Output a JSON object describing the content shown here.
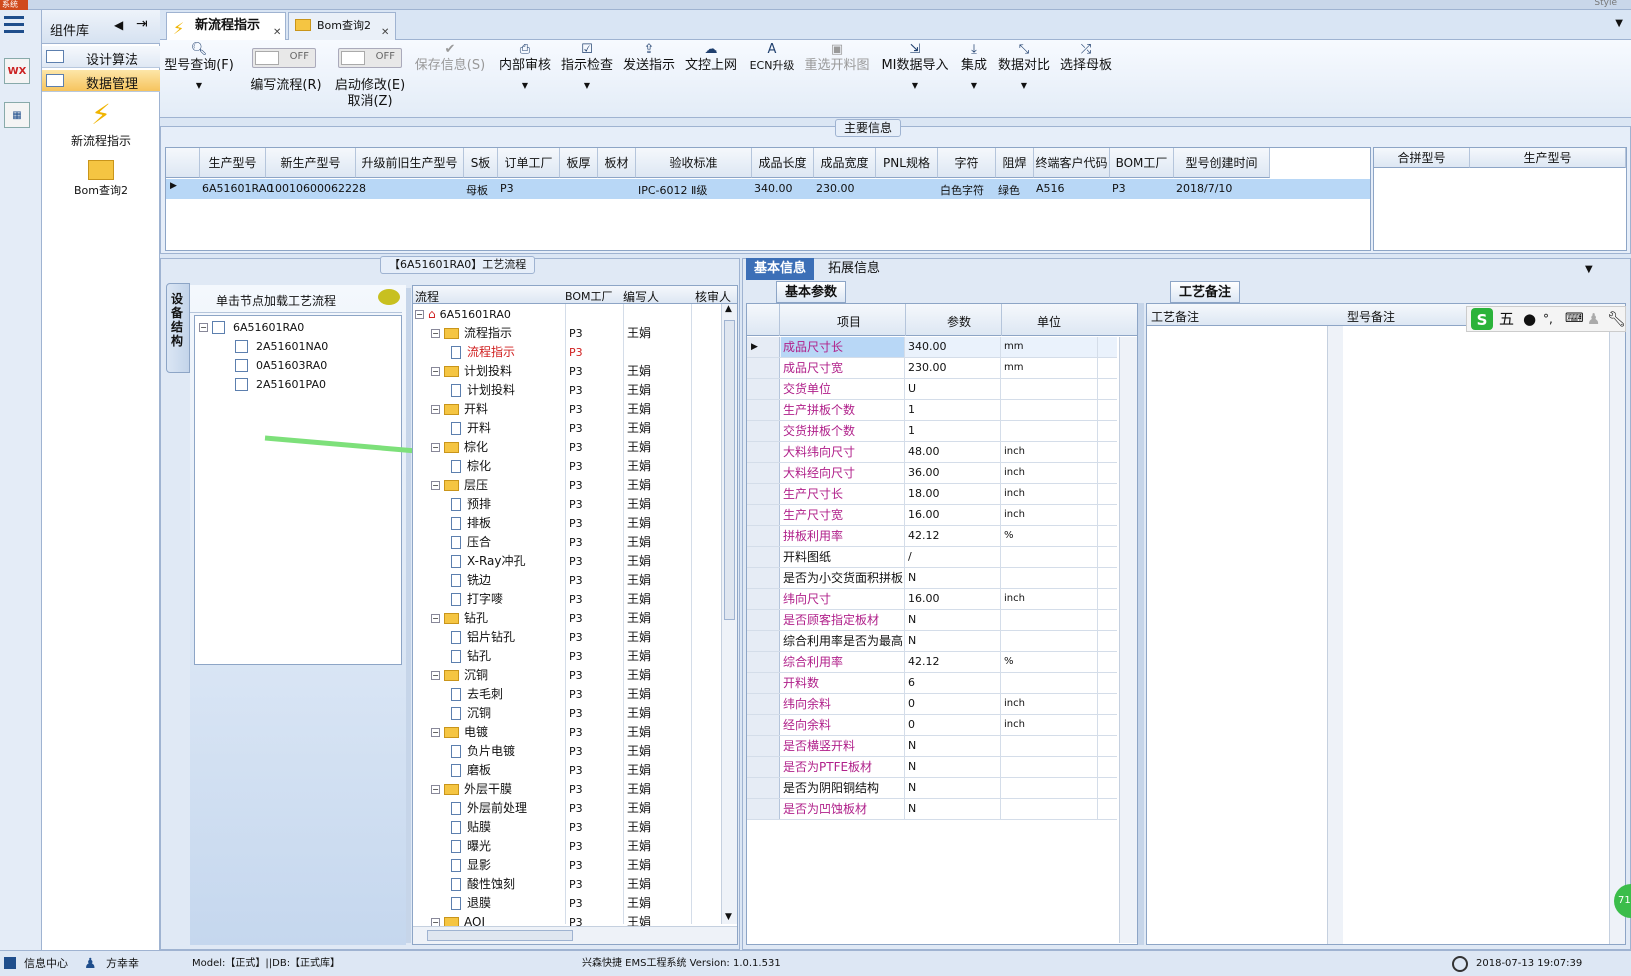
{
  "window": {
    "title_fragment": "系统",
    "style_label": "Style"
  },
  "component_panel": {
    "title": "组件库",
    "groups": [
      {
        "label": "设计算法"
      },
      {
        "label": "数据管理"
      }
    ],
    "items": [
      {
        "label": "新流程指示"
      },
      {
        "label": "Bom查询2"
      }
    ]
  },
  "tabs": [
    {
      "label": "新流程指示"
    },
    {
      "label": "Bom查询2"
    }
  ],
  "toolbar": {
    "model_query": "型号查询(F)",
    "write_flow": "编写流程(R)",
    "start_modify": "启动修改(E)",
    "cancel": "取消(Z)",
    "toggle_off": "OFF",
    "save": "保存信息(S)",
    "internal_review": "内部审核",
    "instruct_check": "指示检查",
    "send_instruct": "发送指示",
    "doc_upload": "文控上网",
    "ecn_upgrade": "ECN升级",
    "reselect_cut": "重选开料图",
    "mi_import": "MI数据导入",
    "integrate": "集成",
    "data_compare": "数据对比",
    "select_mother": "选择母板"
  },
  "main_info": {
    "title": "主要信息",
    "columns": [
      "生产型号",
      "新生产型号",
      "升级前旧生产型号",
      "S板",
      "订单工厂",
      "板厚",
      "板材",
      "验收标准",
      "成品长度",
      "成品宽度",
      "PNL规格",
      "字符",
      "阻焊",
      "终端客户代码",
      "BOM工厂",
      "型号创建时间"
    ],
    "row": [
      "6A51601RA0",
      "10010600062228",
      "",
      "母板",
      "P3",
      "",
      "",
      "IPC-6012 Ⅱ级",
      "340.00",
      "230.00",
      "",
      "白色字符",
      "绿色",
      "A516",
      "P3",
      "2018/7/10"
    ],
    "side_columns": [
      "合拼型号",
      "生产型号"
    ]
  },
  "flow_section": {
    "title": "【6A51601RA0】工艺流程"
  },
  "device_tree": {
    "vtab": "设备结构",
    "header": "单击节点加载工艺流程",
    "root": "6A51601RA0",
    "children": [
      "2A51601NA0",
      "0A51603RA0",
      "2A51601PA0"
    ]
  },
  "process_tree": {
    "columns": [
      "流程",
      "BOM工厂",
      "编写人",
      "核审人"
    ],
    "root": "6A51601RA0",
    "nodes": [
      {
        "t": "流程指示",
        "lvl": 1,
        "folder": true,
        "f": "P3",
        "w": "王娟"
      },
      {
        "t": "流程指示",
        "lvl": 2,
        "f": "P3",
        "w": "",
        "red": true
      },
      {
        "t": "计划投料",
        "lvl": 1,
        "folder": true,
        "f": "P3",
        "w": "王娟"
      },
      {
        "t": "计划投料",
        "lvl": 2,
        "f": "P3",
        "w": "王娟"
      },
      {
        "t": "开料",
        "lvl": 1,
        "folder": true,
        "f": "P3",
        "w": "王娟"
      },
      {
        "t": "开料",
        "lvl": 2,
        "f": "P3",
        "w": "王娟"
      },
      {
        "t": "棕化",
        "lvl": 1,
        "folder": true,
        "f": "P3",
        "w": "王娟"
      },
      {
        "t": "棕化",
        "lvl": 2,
        "f": "P3",
        "w": "王娟"
      },
      {
        "t": "层压",
        "lvl": 1,
        "folder": true,
        "f": "P3",
        "w": "王娟"
      },
      {
        "t": "预排",
        "lvl": 2,
        "f": "P3",
        "w": "王娟"
      },
      {
        "t": "排板",
        "lvl": 2,
        "f": "P3",
        "w": "王娟"
      },
      {
        "t": "压合",
        "lvl": 2,
        "f": "P3",
        "w": "王娟"
      },
      {
        "t": "X-Ray冲孔",
        "lvl": 2,
        "f": "P3",
        "w": "王娟"
      },
      {
        "t": "铣边",
        "lvl": 2,
        "f": "P3",
        "w": "王娟"
      },
      {
        "t": "打字嘜",
        "lvl": 2,
        "f": "P3",
        "w": "王娟"
      },
      {
        "t": "钻孔",
        "lvl": 1,
        "folder": true,
        "f": "P3",
        "w": "王娟"
      },
      {
        "t": "铝片钻孔",
        "lvl": 2,
        "f": "P3",
        "w": "王娟"
      },
      {
        "t": "钻孔",
        "lvl": 2,
        "f": "P3",
        "w": "王娟"
      },
      {
        "t": "沉铜",
        "lvl": 1,
        "folder": true,
        "f": "P3",
        "w": "王娟"
      },
      {
        "t": "去毛刺",
        "lvl": 2,
        "f": "P3",
        "w": "王娟"
      },
      {
        "t": "沉铜",
        "lvl": 2,
        "f": "P3",
        "w": "王娟"
      },
      {
        "t": "电镀",
        "lvl": 1,
        "folder": true,
        "f": "P3",
        "w": "王娟"
      },
      {
        "t": "负片电镀",
        "lvl": 2,
        "f": "P3",
        "w": "王娟"
      },
      {
        "t": "磨板",
        "lvl": 2,
        "f": "P3",
        "w": "王娟"
      },
      {
        "t": "外层干膜",
        "lvl": 1,
        "folder": true,
        "f": "P3",
        "w": "王娟"
      },
      {
        "t": "外层前处理",
        "lvl": 2,
        "f": "P3",
        "w": "王娟"
      },
      {
        "t": "贴膜",
        "lvl": 2,
        "f": "P3",
        "w": "王娟"
      },
      {
        "t": "曝光",
        "lvl": 2,
        "f": "P3",
        "w": "王娟"
      },
      {
        "t": "显影",
        "lvl": 2,
        "f": "P3",
        "w": "王娟"
      },
      {
        "t": "酸性蚀刻",
        "lvl": 2,
        "f": "P3",
        "w": "王娟"
      },
      {
        "t": "退膜",
        "lvl": 2,
        "f": "P3",
        "w": "王娟"
      },
      {
        "t": "AOI",
        "lvl": 1,
        "folder": true,
        "f": "P3",
        "w": "王娟"
      }
    ]
  },
  "right_tabs": {
    "basic": "基本信息",
    "extended": "拓展信息"
  },
  "params": {
    "subtab": "基本参数",
    "columns": [
      "项目",
      "参数",
      "单位"
    ],
    "rows": [
      {
        "k": "成品尺寸长",
        "v": "340.00",
        "u": "mm",
        "pk": true
      },
      {
        "k": "成品尺寸宽",
        "v": "230.00",
        "u": "mm",
        "pk": true
      },
      {
        "k": "交货单位",
        "v": "U",
        "u": "",
        "pk": true
      },
      {
        "k": "生产拼板个数",
        "v": "1",
        "u": "",
        "pk": true
      },
      {
        "k": "交货拼板个数",
        "v": "1",
        "u": "",
        "pk": true
      },
      {
        "k": "大料纬向尺寸",
        "v": "48.00",
        "u": "inch",
        "pk": true
      },
      {
        "k": "大料经向尺寸",
        "v": "36.00",
        "u": "inch",
        "pk": true
      },
      {
        "k": "生产尺寸长",
        "v": "18.00",
        "u": "inch",
        "pk": true
      },
      {
        "k": "生产尺寸宽",
        "v": "16.00",
        "u": "inch",
        "pk": true
      },
      {
        "k": "拼板利用率",
        "v": "42.12",
        "u": "%",
        "pk": true
      },
      {
        "k": "开料图纸",
        "v": "/",
        "u": "",
        "pk": false
      },
      {
        "k": "是否为小交货面积拼板",
        "v": "N",
        "u": "",
        "pk": false
      },
      {
        "k": "纬向尺寸",
        "v": "16.00",
        "u": "inch",
        "pk": true
      },
      {
        "k": "是否顾客指定板材",
        "v": "N",
        "u": "",
        "pk": true
      },
      {
        "k": "综合利用率是否为最高",
        "v": "N",
        "u": "",
        "pk": false
      },
      {
        "k": "综合利用率",
        "v": "42.12",
        "u": "%",
        "pk": true
      },
      {
        "k": "开料数",
        "v": "6",
        "u": "",
        "pk": true
      },
      {
        "k": "纬向余料",
        "v": "0",
        "u": "inch",
        "pk": true
      },
      {
        "k": "经向余料",
        "v": "0",
        "u": "inch",
        "pk": true
      },
      {
        "k": "是否横竖开料",
        "v": "N",
        "u": "",
        "pk": true
      },
      {
        "k": "是否为PTFE板材",
        "v": "N",
        "u": "",
        "pk": true
      },
      {
        "k": "是否为阴阳铜结构",
        "v": "N",
        "u": "",
        "pk": false
      },
      {
        "k": "是否为凹蚀板材",
        "v": "N",
        "u": "",
        "pk": true
      }
    ]
  },
  "notes": {
    "tab": "工艺备注",
    "col1": "工艺备注",
    "col2": "型号备注"
  },
  "ime": {
    "five": "五"
  },
  "status": {
    "info_center": "信息中心",
    "user": "方幸幸",
    "model_db": "Model:【正式】||DB:【正式库】",
    "app": "兴森快捷 EMS工程系统 Version: 1.0.1.531",
    "datetime": "2018-07-13 19:07:39",
    "badge": "71"
  },
  "colors": {
    "accent": "#f6c45e",
    "selected_row": "#b8d7f6",
    "pink_label": "#b0208a",
    "arrow": "#7de07a"
  }
}
